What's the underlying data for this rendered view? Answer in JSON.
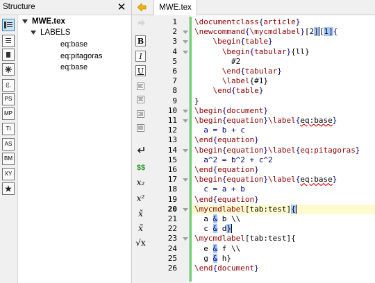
{
  "structure": {
    "title": "Structure",
    "close_glyph": "✕",
    "root_file": "MWE.tex",
    "section_label": "LABELS",
    "labels": [
      "eq:base",
      "eq:pitagoras",
      "eq:base"
    ],
    "toolbar": [
      "",
      "",
      "",
      "",
      "((.",
      "PS",
      "MP",
      "TI",
      "AS",
      "BM",
      "XY",
      ""
    ]
  },
  "editor": {
    "tab_label": "MWE.tex",
    "format_buttons": [
      "B",
      "I",
      "U",
      "",
      "",
      "",
      "",
      "↵",
      "$$",
      "x₂",
      "x²",
      "x̌",
      "x̃",
      "√x"
    ]
  },
  "code_lines": [
    [
      [
        "\\documentclass",
        "kw"
      ],
      [
        "{",
        "bn"
      ],
      [
        "article",
        "kw"
      ],
      [
        "}",
        "bn"
      ]
    ],
    [
      [
        "\\newcommand",
        "kw"
      ],
      [
        "{",
        "bn"
      ],
      [
        "\\mycmdlabel",
        "kw"
      ],
      [
        "}",
        "bn"
      ],
      [
        "[2",
        ""
      ],
      [
        "]",
        "cursor-hl"
      ],
      [
        "[",
        ""
      ],
      [
        "1",
        "hl"
      ],
      [
        "]",
        "hl"
      ],
      [
        "{",
        "bn"
      ]
    ],
    [
      [
        "    ",
        ""
      ],
      [
        "\\begin",
        "kw"
      ],
      [
        "{",
        "bn"
      ],
      [
        "table",
        "kw"
      ],
      [
        "}",
        "bn"
      ]
    ],
    [
      [
        "      ",
        ""
      ],
      [
        "\\begin",
        "kw"
      ],
      [
        "{",
        "bn"
      ],
      [
        "tabular",
        "kw"
      ],
      [
        "}",
        "bn"
      ],
      [
        "{ll}",
        ""
      ]
    ],
    [
      [
        "        #2",
        ""
      ]
    ],
    [
      [
        "      ",
        ""
      ],
      [
        "\\end",
        "kw"
      ],
      [
        "{",
        "bn"
      ],
      [
        "tabular",
        "kw"
      ],
      [
        "}",
        "bn"
      ]
    ],
    [
      [
        "      ",
        ""
      ],
      [
        "\\label",
        "kw"
      ],
      [
        "{#1}",
        ""
      ]
    ],
    [
      [
        "    ",
        ""
      ],
      [
        "\\end",
        "kw"
      ],
      [
        "{",
        "bn"
      ],
      [
        "table",
        "kw"
      ],
      [
        "}",
        "bn"
      ]
    ],
    [
      [
        "}",
        ""
      ]
    ],
    [
      [
        "\\begin",
        "kw"
      ],
      [
        "{",
        "bn"
      ],
      [
        "document",
        "kw"
      ],
      [
        "}",
        "bn"
      ]
    ],
    [
      [
        "\\begin",
        "kw"
      ],
      [
        "{",
        "bn"
      ],
      [
        "equation",
        "kw"
      ],
      [
        "}",
        "bn"
      ],
      [
        "\\label",
        "kw"
      ],
      [
        "{",
        "bn"
      ],
      [
        "eq:base",
        "err"
      ],
      [
        "}",
        "bn"
      ]
    ],
    [
      [
        "  ",
        ""
      ],
      [
        "a = b + c",
        "mt"
      ]
    ],
    [
      [
        "\\end",
        "kw"
      ],
      [
        "{",
        "bn"
      ],
      [
        "equation",
        "kw"
      ],
      [
        "}",
        "bn"
      ]
    ],
    [
      [
        "\\begin",
        "kw"
      ],
      [
        "{",
        "bn"
      ],
      [
        "equation",
        "kw"
      ],
      [
        "}",
        "bn"
      ],
      [
        "\\label",
        "kw"
      ],
      [
        "{",
        "bn"
      ],
      [
        "eq:pitagoras",
        "kw"
      ],
      [
        "}",
        "bn"
      ]
    ],
    [
      [
        "  ",
        ""
      ],
      [
        "a^2 = b^2 + c^2",
        "mt"
      ]
    ],
    [
      [
        "\\end",
        "kw"
      ],
      [
        "{",
        "bn"
      ],
      [
        "equation",
        "kw"
      ],
      [
        "}",
        "bn"
      ]
    ],
    [
      [
        "\\begin",
        "kw"
      ],
      [
        "{",
        "bn"
      ],
      [
        "equation",
        "kw"
      ],
      [
        "}",
        "bn"
      ],
      [
        "\\label",
        "kw"
      ],
      [
        "{",
        "bn"
      ],
      [
        "eq:base",
        "err"
      ],
      [
        "}",
        "bn"
      ]
    ],
    [
      [
        "  ",
        ""
      ],
      [
        "c = a + b",
        "mt"
      ]
    ],
    [
      [
        "\\end",
        "kw"
      ],
      [
        "{",
        "bn"
      ],
      [
        "equation",
        "kw"
      ],
      [
        "}",
        "bn"
      ]
    ],
    [
      [
        "\\mycmdlabel",
        "kw"
      ],
      [
        "[tab:test]",
        ""
      ],
      [
        "{",
        "cursor-hl"
      ]
    ],
    [
      [
        "  a ",
        ""
      ],
      [
        "&",
        "hl-bn"
      ],
      [
        " b \\\\",
        ""
      ]
    ],
    [
      [
        "  c ",
        ""
      ],
      [
        "&",
        "hl-bn"
      ],
      [
        " d",
        ""
      ],
      [
        "}",
        "cursor-hl"
      ]
    ],
    [
      [
        "\\mycmdlabel",
        "kw"
      ],
      [
        "[tab:test]{",
        ""
      ]
    ],
    [
      [
        "  e ",
        ""
      ],
      [
        "&",
        "hl-bn"
      ],
      [
        " f \\\\",
        ""
      ]
    ],
    [
      [
        "  g ",
        ""
      ],
      [
        "&",
        "hl-bn"
      ],
      [
        " h}",
        ""
      ]
    ],
    [
      [
        "\\end",
        "kw"
      ],
      [
        "{",
        "bn"
      ],
      [
        "document",
        "kw"
      ],
      [
        "}",
        "bn"
      ]
    ]
  ],
  "current_line": 20,
  "colors": {
    "keyword": "#8b0000",
    "brace": "#000080",
    "change_bar": "#6fd16f",
    "current_line": "#fffbd0",
    "match_highlight": "#a6c8ff"
  }
}
